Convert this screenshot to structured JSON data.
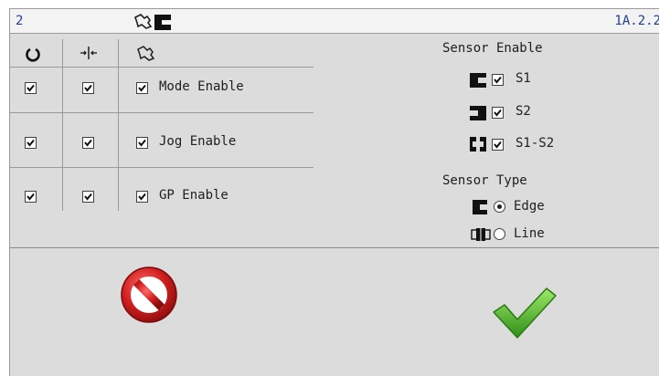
{
  "title_bar": {
    "number": "2",
    "version": "1A.2.2"
  },
  "table": {
    "header_icons": [
      "rotate-icon",
      "center-split-icon",
      "hand-icon"
    ],
    "rows": [
      {
        "col1_checked": true,
        "col2_checked": true,
        "enable_checked": true,
        "label": "Mode Enable"
      },
      {
        "col1_checked": true,
        "col2_checked": true,
        "enable_checked": true,
        "label": "Jog Enable"
      },
      {
        "col1_checked": true,
        "col2_checked": true,
        "enable_checked": true,
        "label": "GP Enable"
      }
    ]
  },
  "sensor_enable": {
    "heading": "Sensor Enable",
    "items": [
      {
        "icon": "sensor-s1-icon",
        "checked": true,
        "label": "S1"
      },
      {
        "icon": "sensor-s2-icon",
        "checked": true,
        "label": "S2"
      },
      {
        "icon": "sensor-s1-s2-icon",
        "checked": true,
        "label": "S1-S2"
      }
    ]
  },
  "sensor_type": {
    "heading": "Sensor Type",
    "options": [
      {
        "icon": "sensor-edge-icon",
        "selected": true,
        "label": "Edge"
      },
      {
        "icon": "sensor-line-icon",
        "selected": false,
        "label": "Line"
      }
    ]
  },
  "actions": {
    "cancel_icon": "cancel-icon",
    "confirm_icon": "checkmark-icon",
    "cancel_color": "#cc1f1f",
    "confirm_color": "#3fae1f"
  }
}
